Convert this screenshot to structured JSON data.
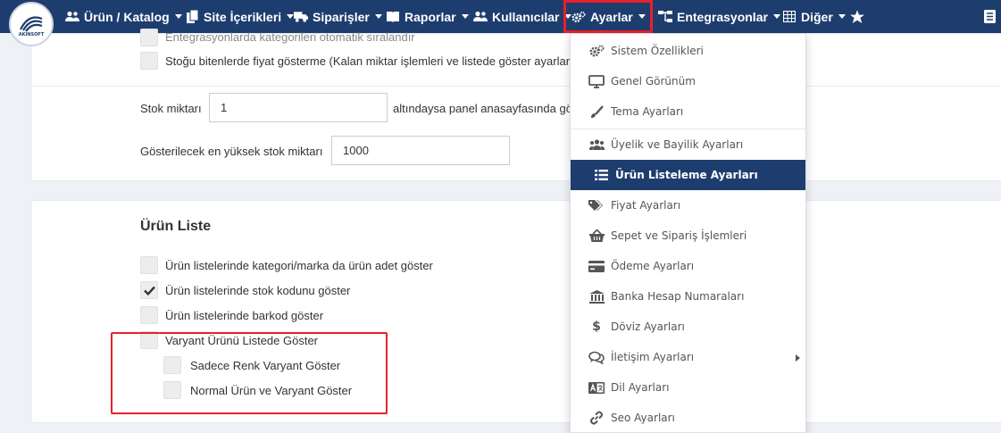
{
  "brand": {
    "logo_text": "AKINSOFT"
  },
  "nav": {
    "items": [
      {
        "label": "Ürün / Katalog",
        "icon": "users-icon"
      },
      {
        "label": "Site İçerikleri",
        "icon": "files-icon"
      },
      {
        "label": "Siparişler",
        "icon": "truck-icon"
      },
      {
        "label": "Raporlar",
        "icon": "report-icon"
      },
      {
        "label": "Kullanıcılar",
        "icon": "users-icon"
      },
      {
        "label": "Ayarlar",
        "icon": "gears-icon"
      },
      {
        "label": "Entegrasyonlar",
        "icon": "sitemap-icon"
      },
      {
        "label": "Diğer",
        "icon": "grid-icon"
      }
    ]
  },
  "settings_top": {
    "cb1_label": "Entegrasyonlarda kategorileri otomatik sıralandır",
    "cb2_label": "Stoğu bitenlerde fiyat gösterme (Kalan miktar işlemleri ve listede göster ayarları",
    "stock_label": "Stok miktarı",
    "stock_value": "1",
    "stock_suffix": "altındaysa panel anasayfasında gö",
    "max_stock_label": "Gösterilecek en yüksek stok miktarı",
    "max_stock_value": "1000"
  },
  "product_list": {
    "title": "Ürün Liste",
    "options": [
      {
        "label": "Ürün listelerinde kategori/marka da ürün adet göster",
        "checked": false
      },
      {
        "label": "Ürün listelerinde stok kodunu göster",
        "checked": true
      },
      {
        "label": "Ürün listelerinde barkod göster",
        "checked": false
      },
      {
        "label": "Varyant Ürünü Listede Göster",
        "checked": false
      }
    ],
    "sub_options": [
      {
        "label": "Sadece Renk Varyant Göster",
        "checked": false
      },
      {
        "label": "Normal Ürün ve Varyant Göster",
        "checked": false
      }
    ]
  },
  "dropdown": {
    "items": [
      {
        "label": "Sistem Özellikleri",
        "icon": "gears-icon"
      },
      {
        "label": "Genel Görünüm",
        "icon": "monitor-icon"
      },
      {
        "label": "Tema Ayarları",
        "icon": "brush-icon"
      },
      {
        "label": "Üyelik ve Bayilik Ayarları",
        "icon": "users-icon"
      },
      {
        "label": "Ürün Listeleme Ayarları",
        "icon": "list-icon"
      },
      {
        "label": "Fiyat Ayarları",
        "icon": "tags-icon"
      },
      {
        "label": "Sepet ve Sipariş İşlemleri",
        "icon": "basket-icon"
      },
      {
        "label": "Ödeme Ayarları",
        "icon": "credit-card-icon"
      },
      {
        "label": "Banka Hesap Numaraları",
        "icon": "bank-icon"
      },
      {
        "label": "Döviz Ayarları",
        "icon": "dollar-icon"
      },
      {
        "label": "İletişim Ayarları",
        "icon": "comments-icon"
      },
      {
        "label": "Dil Ayarları",
        "icon": "language-icon"
      },
      {
        "label": "Seo Ayarları",
        "icon": "link-icon"
      }
    ]
  },
  "colors": {
    "navbar": "#1e3d6f",
    "highlight": "#e8202a",
    "active_item": "#1e3d6f"
  }
}
